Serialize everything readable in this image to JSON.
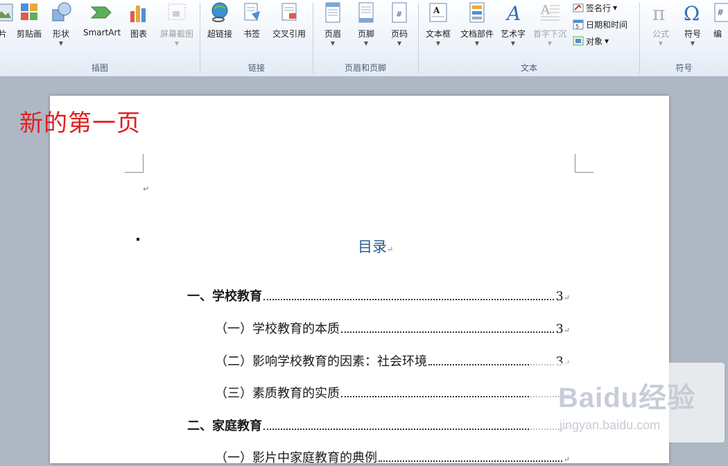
{
  "ribbon": {
    "groups": {
      "illustrations": "插图",
      "links": "链接",
      "header_footer": "页眉和页脚",
      "text": "文本",
      "symbols": "符号"
    },
    "buttons": {
      "picture": "片",
      "clipart": "剪贴画",
      "shapes": "形状",
      "smartart": "SmartArt",
      "chart": "图表",
      "screenshot": "屏幕截图",
      "hyperlink": "超链接",
      "bookmark": "书签",
      "crossref": "交叉引用",
      "header": "页眉",
      "footer": "页脚",
      "page_number": "页码",
      "textbox": "文本框",
      "quickparts": "文档部件",
      "wordart": "艺术字",
      "dropcap": "首字下沉",
      "signature": "签名行",
      "datetime": "日期和时间",
      "object": "对象",
      "equation": "公式",
      "symbol": "符号",
      "edit": "编"
    }
  },
  "overlay_title": "新的第一页",
  "document": {
    "toc_title": "目录",
    "toc": [
      {
        "text": "一、学校教育",
        "page": "3",
        "level": 1
      },
      {
        "text": "（一）学校教育的本质",
        "page": "3",
        "level": 2
      },
      {
        "text": "（二）影响学校教育的因素：社会环境",
        "page": "3",
        "level": 2
      },
      {
        "text": "（三）素质教育的实质",
        "page": "",
        "level": 2
      },
      {
        "text": "二、家庭教育",
        "page": "",
        "level": 1
      },
      {
        "text": "（一）影片中家庭教育的典例",
        "page": "",
        "level": 2
      }
    ]
  },
  "watermark": {
    "brand": "Baidu经验",
    "url": "jingyan.baidu.com"
  },
  "colors": {
    "overlay_title": "#e02020",
    "toc_title": "#2e5b8f",
    "workspace": "#aeb7c4"
  }
}
